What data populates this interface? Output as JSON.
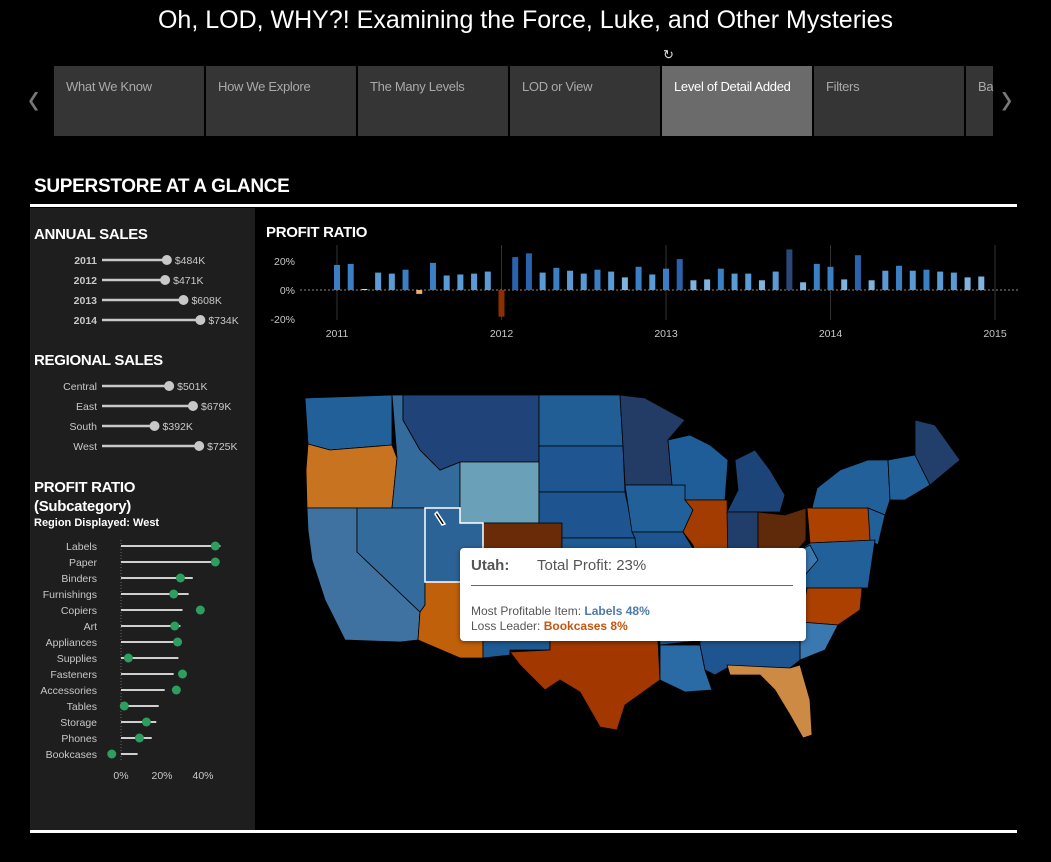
{
  "story": {
    "title": "Oh, LOD, WHY?! Examining the Force, Luke, and Other Mysteries",
    "reset_icon": "revert-icon",
    "prev_icon": "chevron-left-icon",
    "next_icon": "chevron-right-icon",
    "tabs": [
      {
        "label": "What We Know",
        "active": false
      },
      {
        "label": "How We Explore",
        "active": false
      },
      {
        "label": "The Many Levels",
        "active": false
      },
      {
        "label": "LOD or View",
        "active": false
      },
      {
        "label": "Level of Detail Added",
        "active": true
      },
      {
        "label": "Filters",
        "active": false
      },
      {
        "label": "Ba",
        "active": false
      }
    ]
  },
  "dashboard": {
    "title": "SUPERSTORE AT A GLANCE",
    "annual_sales": {
      "title": "ANNUAL SALES",
      "rows": [
        {
          "label": "2011",
          "value": 484,
          "text": "$484K"
        },
        {
          "label": "2012",
          "value": 471,
          "text": "$471K"
        },
        {
          "label": "2013",
          "value": 608,
          "text": "$608K"
        },
        {
          "label": "2014",
          "value": 734,
          "text": "$734K"
        }
      ]
    },
    "regional_sales": {
      "title": "REGIONAL SALES",
      "rows": [
        {
          "label": "Central",
          "value": 501,
          "text": "$501K"
        },
        {
          "label": "East",
          "value": 679,
          "text": "$679K"
        },
        {
          "label": "South",
          "value": 392,
          "text": "$392K"
        },
        {
          "label": "West",
          "value": 725,
          "text": "$725K"
        }
      ]
    },
    "subcategory": {
      "title": "PROFIT RATIO",
      "subtitle": "(Subcategory)",
      "region_note": "Region Displayed: West",
      "ticks": [
        "0%",
        "20%",
        "40%"
      ],
      "rows": [
        {
          "label": "Labels",
          "region": 46,
          "overall": 48.5
        },
        {
          "label": "Paper",
          "region": 46,
          "overall": 48
        },
        {
          "label": "Binders",
          "region": 29,
          "overall": 35
        },
        {
          "label": "Furnishings",
          "region": 25.7,
          "overall": 33
        },
        {
          "label": "Copiers",
          "region": 38.7,
          "overall": 30
        },
        {
          "label": "Art",
          "region": 26.2,
          "overall": 29
        },
        {
          "label": "Appliances",
          "region": 27.6,
          "overall": 27.6
        },
        {
          "label": "Supplies",
          "region": 3.6,
          "overall": 28
        },
        {
          "label": "Fasteners",
          "region": 30,
          "overall": 25.7
        },
        {
          "label": "Accessories",
          "region": 27,
          "overall": 21.3
        },
        {
          "label": "Tables",
          "region": 1.6,
          "overall": 18.4
        },
        {
          "label": "Storage",
          "region": 12.4,
          "overall": 17.2
        },
        {
          "label": "Phones",
          "region": 9,
          "overall": 15
        },
        {
          "label": "Bookcases",
          "region": -4.5,
          "overall": 8.1
        }
      ]
    },
    "colors": {
      "dot": "#c8c8c8",
      "subcat_dot": "#2e9e5e",
      "panel": "#1e1e1e"
    },
    "tooltip": {
      "state": "Utah:",
      "total_profit": "Total Profit: 23%",
      "most_label": "Most Profitable Item: ",
      "most_value": "Labels 48%",
      "loss_label": "Loss Leader: ",
      "loss_value": "Bookcases 8%"
    }
  },
  "chart_data": {
    "type": "bar",
    "title": "PROFIT RATIO",
    "x_ticks": [
      "2011",
      "2012",
      "2013",
      "2014",
      "2015"
    ],
    "y_ticks": [
      "20%",
      "0%",
      "-20%"
    ],
    "ylim": [
      -25,
      30
    ],
    "x_unit": "month",
    "start": "2011-01",
    "values": [
      17.3,
      18,
      0.7,
      12,
      11.3,
      14,
      -2.7,
      18.7,
      10,
      10.7,
      11.3,
      12.7,
      -18.4,
      22.7,
      25.3,
      12,
      15.3,
      13.3,
      11.3,
      14,
      12.7,
      8.7,
      16,
      10.7,
      14.7,
      21.3,
      6.7,
      7.3,
      14.7,
      11.3,
      11.3,
      6.7,
      12.7,
      28,
      5.3,
      18,
      16,
      7.3,
      24,
      6.7,
      13.3,
      16.7,
      13.3,
      14,
      12.7,
      12,
      8.7,
      9.3
    ]
  }
}
